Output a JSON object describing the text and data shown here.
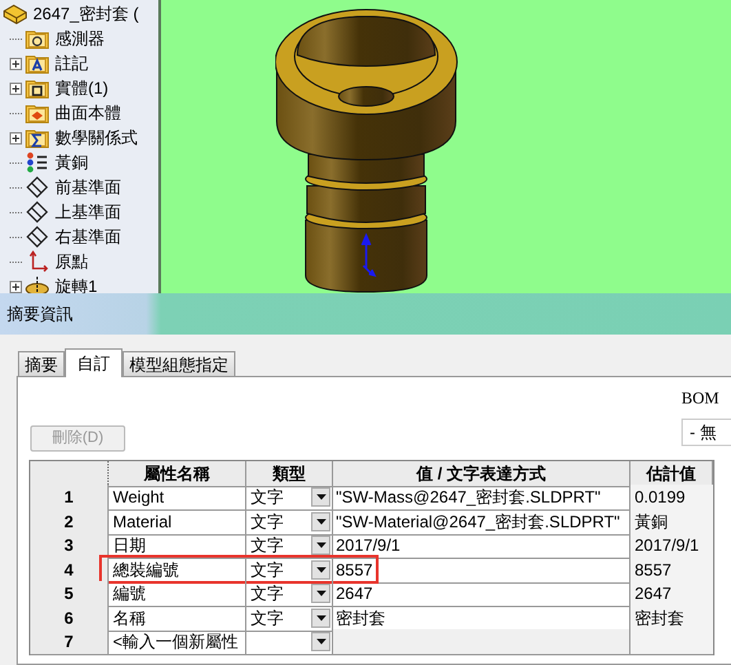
{
  "tree": {
    "root": "2647_密封套 (",
    "items": [
      {
        "label": "感測器",
        "kind": "sensor",
        "expandable": false
      },
      {
        "label": "註記",
        "kind": "annotation",
        "expandable": true
      },
      {
        "label": "實體(1)",
        "kind": "solid",
        "expandable": true
      },
      {
        "label": "曲面本體",
        "kind": "surface",
        "expandable": false
      },
      {
        "label": "數學關係式",
        "kind": "equation",
        "expandable": true
      },
      {
        "label": "黃銅",
        "kind": "material",
        "expandable": false
      },
      {
        "label": "前基準面",
        "kind": "plane",
        "expandable": false
      },
      {
        "label": "上基準面",
        "kind": "plane",
        "expandable": false
      },
      {
        "label": "右基準面",
        "kind": "plane",
        "expandable": false
      },
      {
        "label": "原點",
        "kind": "origin",
        "expandable": false
      },
      {
        "label": "旋轉1",
        "kind": "revolve",
        "expandable": true
      }
    ]
  },
  "dialog": {
    "title": "摘要資訊",
    "tabs": [
      {
        "label": "摘要",
        "selected": false
      },
      {
        "label": "自訂",
        "selected": true
      },
      {
        "label": "模型組態指定",
        "selected": false
      }
    ],
    "delete_button": {
      "label": "刪除(D)",
      "disabled": true
    },
    "bom_label": "BOM",
    "bom_select": "- 無",
    "table": {
      "columns": [
        "屬性名稱",
        "類型",
        "值 / 文字表達方式",
        "估計值"
      ],
      "rows": [
        {
          "number": "1",
          "name": "Weight",
          "type": "文字",
          "value": "\"SW-Mass@2647_密封套.SLDPRT\"",
          "evaluated": "0.0199",
          "highlighted": false
        },
        {
          "number": "2",
          "name": "Material",
          "type": "文字",
          "value": "\"SW-Material@2647_密封套.SLDPRT\"",
          "evaluated": "黃銅",
          "highlighted": false
        },
        {
          "number": "3",
          "name": "日期",
          "type": "文字",
          "value": "2017/9/1",
          "evaluated": "2017/9/1",
          "highlighted": false
        },
        {
          "number": "4",
          "name": "總裝編號",
          "type": "文字",
          "value": "8557",
          "evaluated": "8557",
          "highlighted": true
        },
        {
          "number": "5",
          "name": "編號",
          "type": "文字",
          "value": "2647",
          "evaluated": "2647",
          "highlighted": false
        },
        {
          "number": "6",
          "name": "名稱",
          "type": "文字",
          "value": "密封套",
          "evaluated": "密封套",
          "highlighted": false
        },
        {
          "number": "7",
          "name": "<輸入一個新屬性",
          "highlighted": false
        }
      ]
    }
  }
}
